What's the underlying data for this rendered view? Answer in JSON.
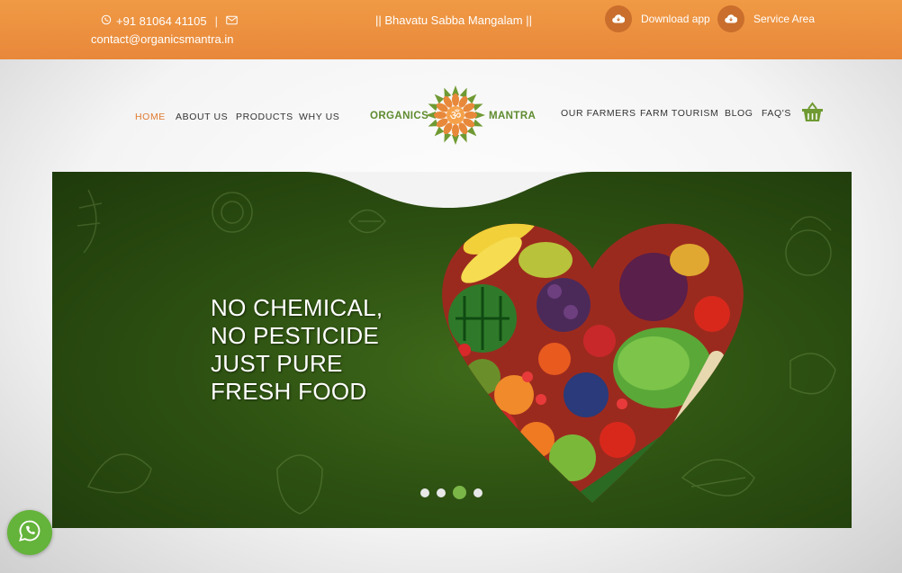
{
  "topbar": {
    "phone": "+91 81064 41105",
    "email": "contact@organicsmantra.in",
    "motto": "|| Bhavatu Sabba Mangalam ||",
    "download_label": "Download app",
    "service_label": "Service Area"
  },
  "nav": {
    "left": [
      "HOME",
      "ABOUT US",
      "PRODUCTS",
      "WHY US"
    ],
    "right": [
      "OUR FARMERS",
      "FARM TOURISM",
      "BLOG",
      "FAQ'S"
    ],
    "active": "HOME"
  },
  "logo": {
    "word_left": "ORGANICS",
    "word_right": "MANTRA",
    "symbol": "ॐ"
  },
  "hero": {
    "lines": [
      "NO CHEMICAL,",
      "NO PESTICIDE",
      "JUST PURE",
      "FRESH FOOD"
    ],
    "slide_count": 4,
    "active_slide": 3
  },
  "colors": {
    "brand_orange": "#e8883a",
    "brand_green": "#5e8b2e",
    "hero_green": "#2e5212",
    "whatsapp": "#64b33a"
  },
  "icons": [
    "whatsapp-icon",
    "envelope-icon",
    "cloud-download-icon",
    "basket-icon"
  ]
}
